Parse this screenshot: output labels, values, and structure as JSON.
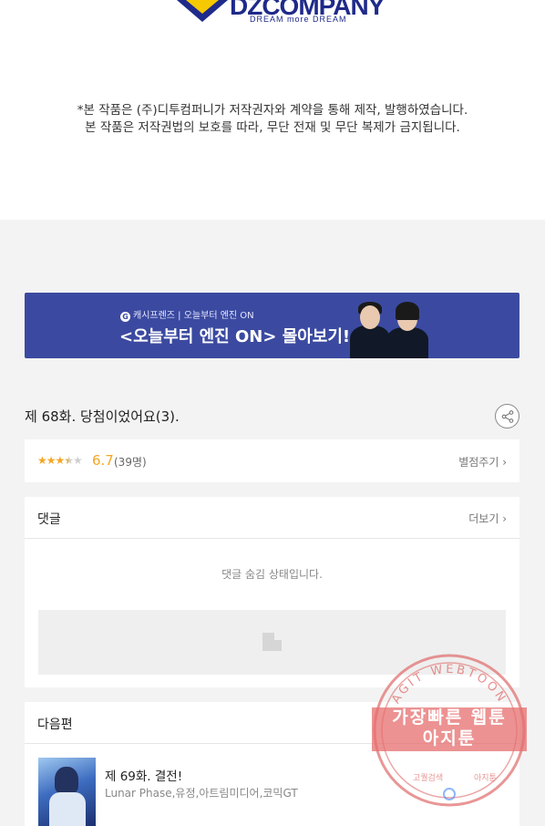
{
  "publisher": {
    "logo_text": "DZCOMPANY",
    "logo_tagline": "DREAM more DREAM",
    "copyright_lines": [
      "*본 작품은 (주)디투컴퍼니가 저작권자와 계약을 통해 제작, 발행하였습니다.",
      "본 작품은 저작권법의 보호를 따라, 무단 전재 및 무단 복제가 금지됩니다."
    ]
  },
  "banner": {
    "badge": "G",
    "small_text": "캐시프렌즈 | 오늘부터 엔진 ON",
    "big_text": "<오늘부터 엔진 ON> 몰아보기!"
  },
  "episode": {
    "title": "제 68화. 당첨이었어요(3)."
  },
  "rating": {
    "stars_filled": "★★★",
    "stars_half": "★",
    "stars_empty": "★",
    "value": 3.35,
    "score": "6.7",
    "count": "(39명)",
    "rate_link": "별점주기 ›"
  },
  "comments": {
    "title": "댓글",
    "more": "더보기 ›",
    "hidden_message": "댓글 숨김 상태입니다."
  },
  "next": {
    "title": "다음편",
    "item_title": "제 69화. 결전!",
    "item_authors": "Lunar Phase,유정,아트림미디어,코믹GT"
  },
  "watermark": {
    "top_arc": "AGIT WEBTOON",
    "line1": "가장빠른 웹툰",
    "line2": "아지툰",
    "bottom_left": "고퀄검색",
    "bottom_right": "아지툰",
    "color": "#e06a6a"
  },
  "colors": {
    "banner_bg": "#3b4aa0",
    "star": "#f5a623",
    "page_bg": "#f3f3f3"
  }
}
